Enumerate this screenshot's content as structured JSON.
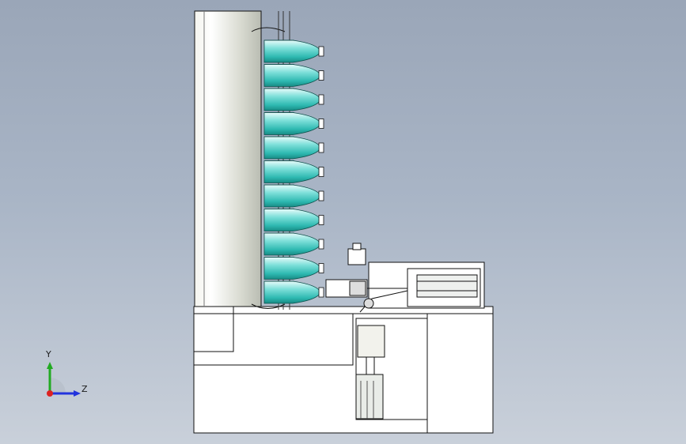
{
  "viewport": {
    "background_top": "#9aa6b8",
    "background_bottom": "#c9d0da",
    "line_color": "#111111",
    "part_fill": "#ffffff",
    "roller_color": "#3cc7bf"
  },
  "triad": {
    "y_label": "Y",
    "z_label": "Z",
    "y_color": "#22aa22",
    "z_color": "#2233dd",
    "x_color": "#dd2222"
  }
}
